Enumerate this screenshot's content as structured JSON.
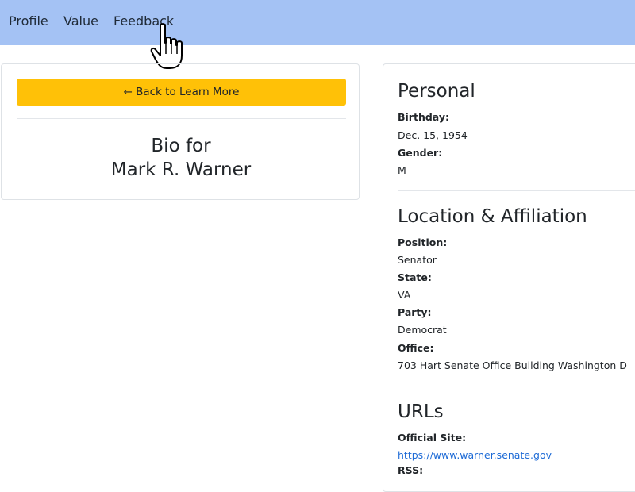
{
  "nav": {
    "items": [
      {
        "label": "Profile"
      },
      {
        "label": "Value"
      },
      {
        "label": "Feedback"
      }
    ]
  },
  "left_card": {
    "back_button": "← Back to Learn More",
    "bio_line1": "Bio for",
    "bio_line2": "Mark R. Warner"
  },
  "personal": {
    "title": "Personal",
    "birthday_label": "Birthday:",
    "birthday_value": "Dec. 15, 1954",
    "gender_label": "Gender:",
    "gender_value": "M"
  },
  "location": {
    "title": "Location & Affiliation",
    "position_label": "Position:",
    "position_value": "Senator",
    "state_label": "State:",
    "state_value": "VA",
    "party_label": "Party:",
    "party_value": "Democrat",
    "office_label": "Office:",
    "office_value": "703 Hart Senate Office Building Washington D"
  },
  "urls": {
    "title": "URLs",
    "official_label": "Official Site:",
    "official_value": "https://www.warner.senate.gov",
    "rss_label": "RSS:"
  },
  "colors": {
    "navbar_bg": "#a4c2f4",
    "back_button_bg": "#ffc107",
    "link": "#1e6bd6"
  },
  "icons": {
    "cursor": "hand-pointer-cursor-icon"
  }
}
